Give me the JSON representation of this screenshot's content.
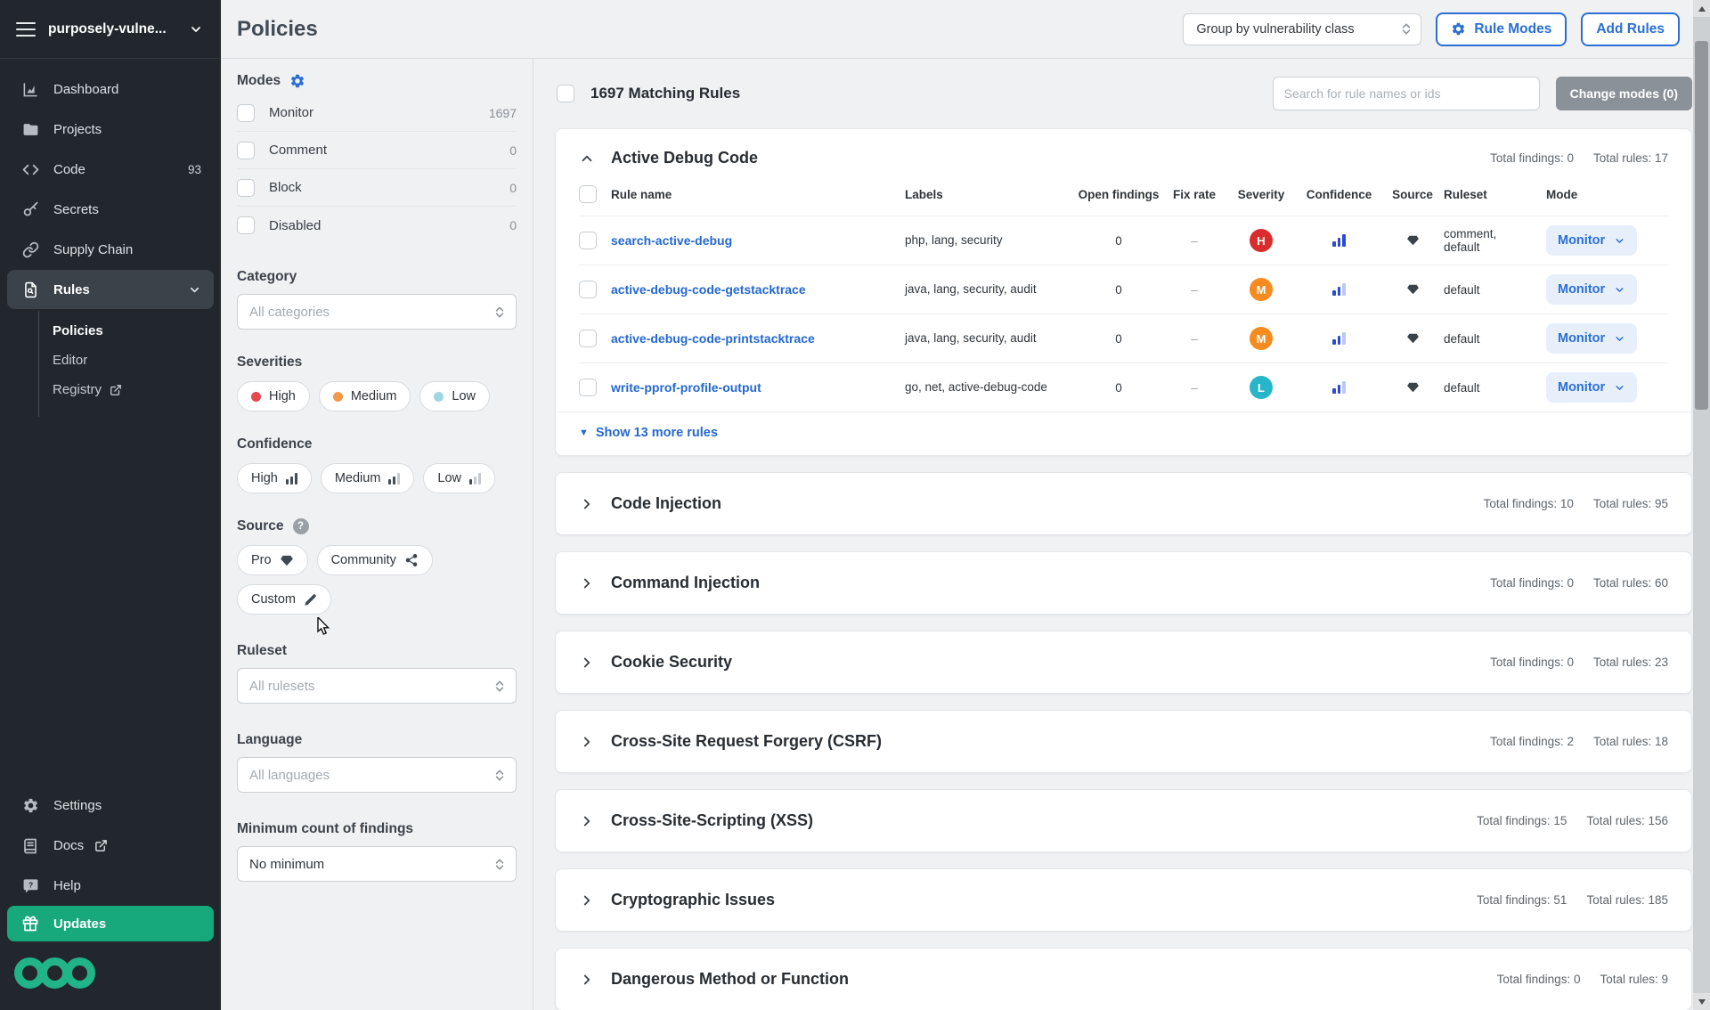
{
  "colors": {
    "accent_blue": "#2b6fd4",
    "sidebar_bg": "#21272c",
    "updates_green": "#17a87b",
    "logo_green": "#21b488",
    "severity_high": "#d92d2d",
    "severity_medium": "#f68b1f",
    "severity_low": "#27b6c9",
    "confidence_bar_blue": "#2b49d8"
  },
  "icons": {
    "org_menu": "hamburger-icon",
    "settings": "gear-icon",
    "pro_source": "gem-icon",
    "community_source": "share-network-icon",
    "custom_source": "pen-icon",
    "section_collapsed": "chevron-right-icon",
    "section_expanded": "chevron-up-icon",
    "select_control": "up-down-chevrons-icon"
  },
  "sidebar": {
    "org_name": "purposely-vulne...",
    "items": [
      {
        "label": "Dashboard"
      },
      {
        "label": "Projects"
      },
      {
        "label": "Code",
        "badge": "93"
      },
      {
        "label": "Secrets"
      },
      {
        "label": "Supply Chain"
      },
      {
        "label": "Rules"
      }
    ],
    "rules_children": [
      {
        "label": "Policies"
      },
      {
        "label": "Editor"
      },
      {
        "label": "Registry"
      }
    ],
    "footer": [
      {
        "label": "Settings"
      },
      {
        "label": "Docs"
      },
      {
        "label": "Help"
      },
      {
        "label": "Updates"
      }
    ]
  },
  "header": {
    "title": "Policies",
    "group_by_value": "Group by vulnerability class",
    "rule_modes_label": "Rule Modes",
    "add_rules_label": "Add Rules"
  },
  "filters": {
    "modes_label": "Modes",
    "modes": [
      {
        "label": "Monitor",
        "count": "1697"
      },
      {
        "label": "Comment",
        "count": "0"
      },
      {
        "label": "Block",
        "count": "0"
      },
      {
        "label": "Disabled",
        "count": "0"
      }
    ],
    "category_label": "Category",
    "category_placeholder": "All categories",
    "severities_label": "Severities",
    "severity_chips": [
      {
        "label": "High"
      },
      {
        "label": "Medium"
      },
      {
        "label": "Low"
      }
    ],
    "confidence_label": "Confidence",
    "confidence_chips": [
      {
        "label": "High"
      },
      {
        "label": "Medium"
      },
      {
        "label": "Low"
      }
    ],
    "source_label": "Source",
    "source_chips": [
      {
        "label": "Pro"
      },
      {
        "label": "Community"
      },
      {
        "label": "Custom"
      }
    ],
    "ruleset_label": "Ruleset",
    "ruleset_placeholder": "All rulesets",
    "language_label": "Language",
    "language_placeholder": "All languages",
    "min_findings_label": "Minimum count of findings",
    "min_findings_value": "No minimum"
  },
  "toolbar": {
    "matching_rules": "1697 Matching Rules",
    "search_placeholder": "Search for rule names or ids",
    "change_modes_label": "Change modes (0)"
  },
  "table": {
    "headers": {
      "rule_name": "Rule name",
      "labels": "Labels",
      "open_findings": "Open findings",
      "fix_rate": "Fix rate",
      "severity": "Severity",
      "confidence": "Confidence",
      "source": "Source",
      "ruleset": "Ruleset",
      "mode": "Mode"
    }
  },
  "sections": [
    {
      "title": "Active Debug Code",
      "total_findings": "Total findings: 0",
      "total_rules": "Total rules: 17",
      "rows": [
        {
          "name": "search-active-debug",
          "labels": "php, lang, security",
          "open_findings": "0",
          "fix_rate": "–",
          "severity_letter": "H",
          "ruleset": "comment, default",
          "mode": "Monitor"
        },
        {
          "name": "active-debug-code-getstacktrace",
          "labels": "java, lang, security, audit",
          "open_findings": "0",
          "fix_rate": "–",
          "severity_letter": "M",
          "ruleset": "default",
          "mode": "Monitor"
        },
        {
          "name": "active-debug-code-printstacktrace",
          "labels": "java, lang, security, audit",
          "open_findings": "0",
          "fix_rate": "–",
          "severity_letter": "M",
          "ruleset": "default",
          "mode": "Monitor"
        },
        {
          "name": "write-pprof-profile-output",
          "labels": "go, net, active-debug-code",
          "open_findings": "0",
          "fix_rate": "–",
          "severity_letter": "L",
          "ruleset": "default",
          "mode": "Monitor"
        }
      ],
      "show_more": "Show 13 more rules"
    },
    {
      "title": "Code Injection",
      "total_findings": "Total findings: 10",
      "total_rules": "Total rules: 95"
    },
    {
      "title": "Command Injection",
      "total_findings": "Total findings: 0",
      "total_rules": "Total rules: 60"
    },
    {
      "title": "Cookie Security",
      "total_findings": "Total findings: 0",
      "total_rules": "Total rules: 23"
    },
    {
      "title": "Cross-Site Request Forgery (CSRF)",
      "total_findings": "Total findings: 2",
      "total_rules": "Total rules: 18"
    },
    {
      "title": "Cross-Site-Scripting (XSS)",
      "total_findings": "Total findings: 15",
      "total_rules": "Total rules: 156"
    },
    {
      "title": "Cryptographic Issues",
      "total_findings": "Total findings: 51",
      "total_rules": "Total rules: 185"
    },
    {
      "title": "Dangerous Method or Function",
      "total_findings": "Total findings: 0",
      "total_rules": "Total rules: 9"
    }
  ]
}
